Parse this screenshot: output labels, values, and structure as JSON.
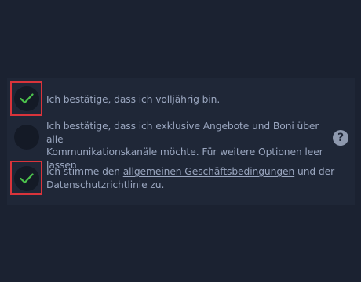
{
  "consents": [
    {
      "checked": true,
      "text": "Ich bestätige, dass ich volljährig bin."
    },
    {
      "checked": false,
      "text_line1": "Ich bestätige, dass ich exklusive Angebote und Boni über alle",
      "text_line2": "Kommunikationskanäle möchte. Für weitere Optionen leer",
      "text_line3": "lassen"
    },
    {
      "checked": true,
      "text_before": "Ich stimme den ",
      "terms_link": "allgemeinen Geschäftsbedingungen",
      "text_middle": " und der",
      "privacy_link": "Datenschutzrichtlinie zu",
      "text_after": "."
    }
  ],
  "help": {
    "icon": "question-circle-icon",
    "glyph": "?"
  },
  "colors": {
    "background": "#1b2231",
    "panel": "#1f2737",
    "checkbox_fill": "#141a26",
    "checkmark": "#4cc24c",
    "highlight": "#d9343b",
    "text": "#9aa6bf"
  }
}
